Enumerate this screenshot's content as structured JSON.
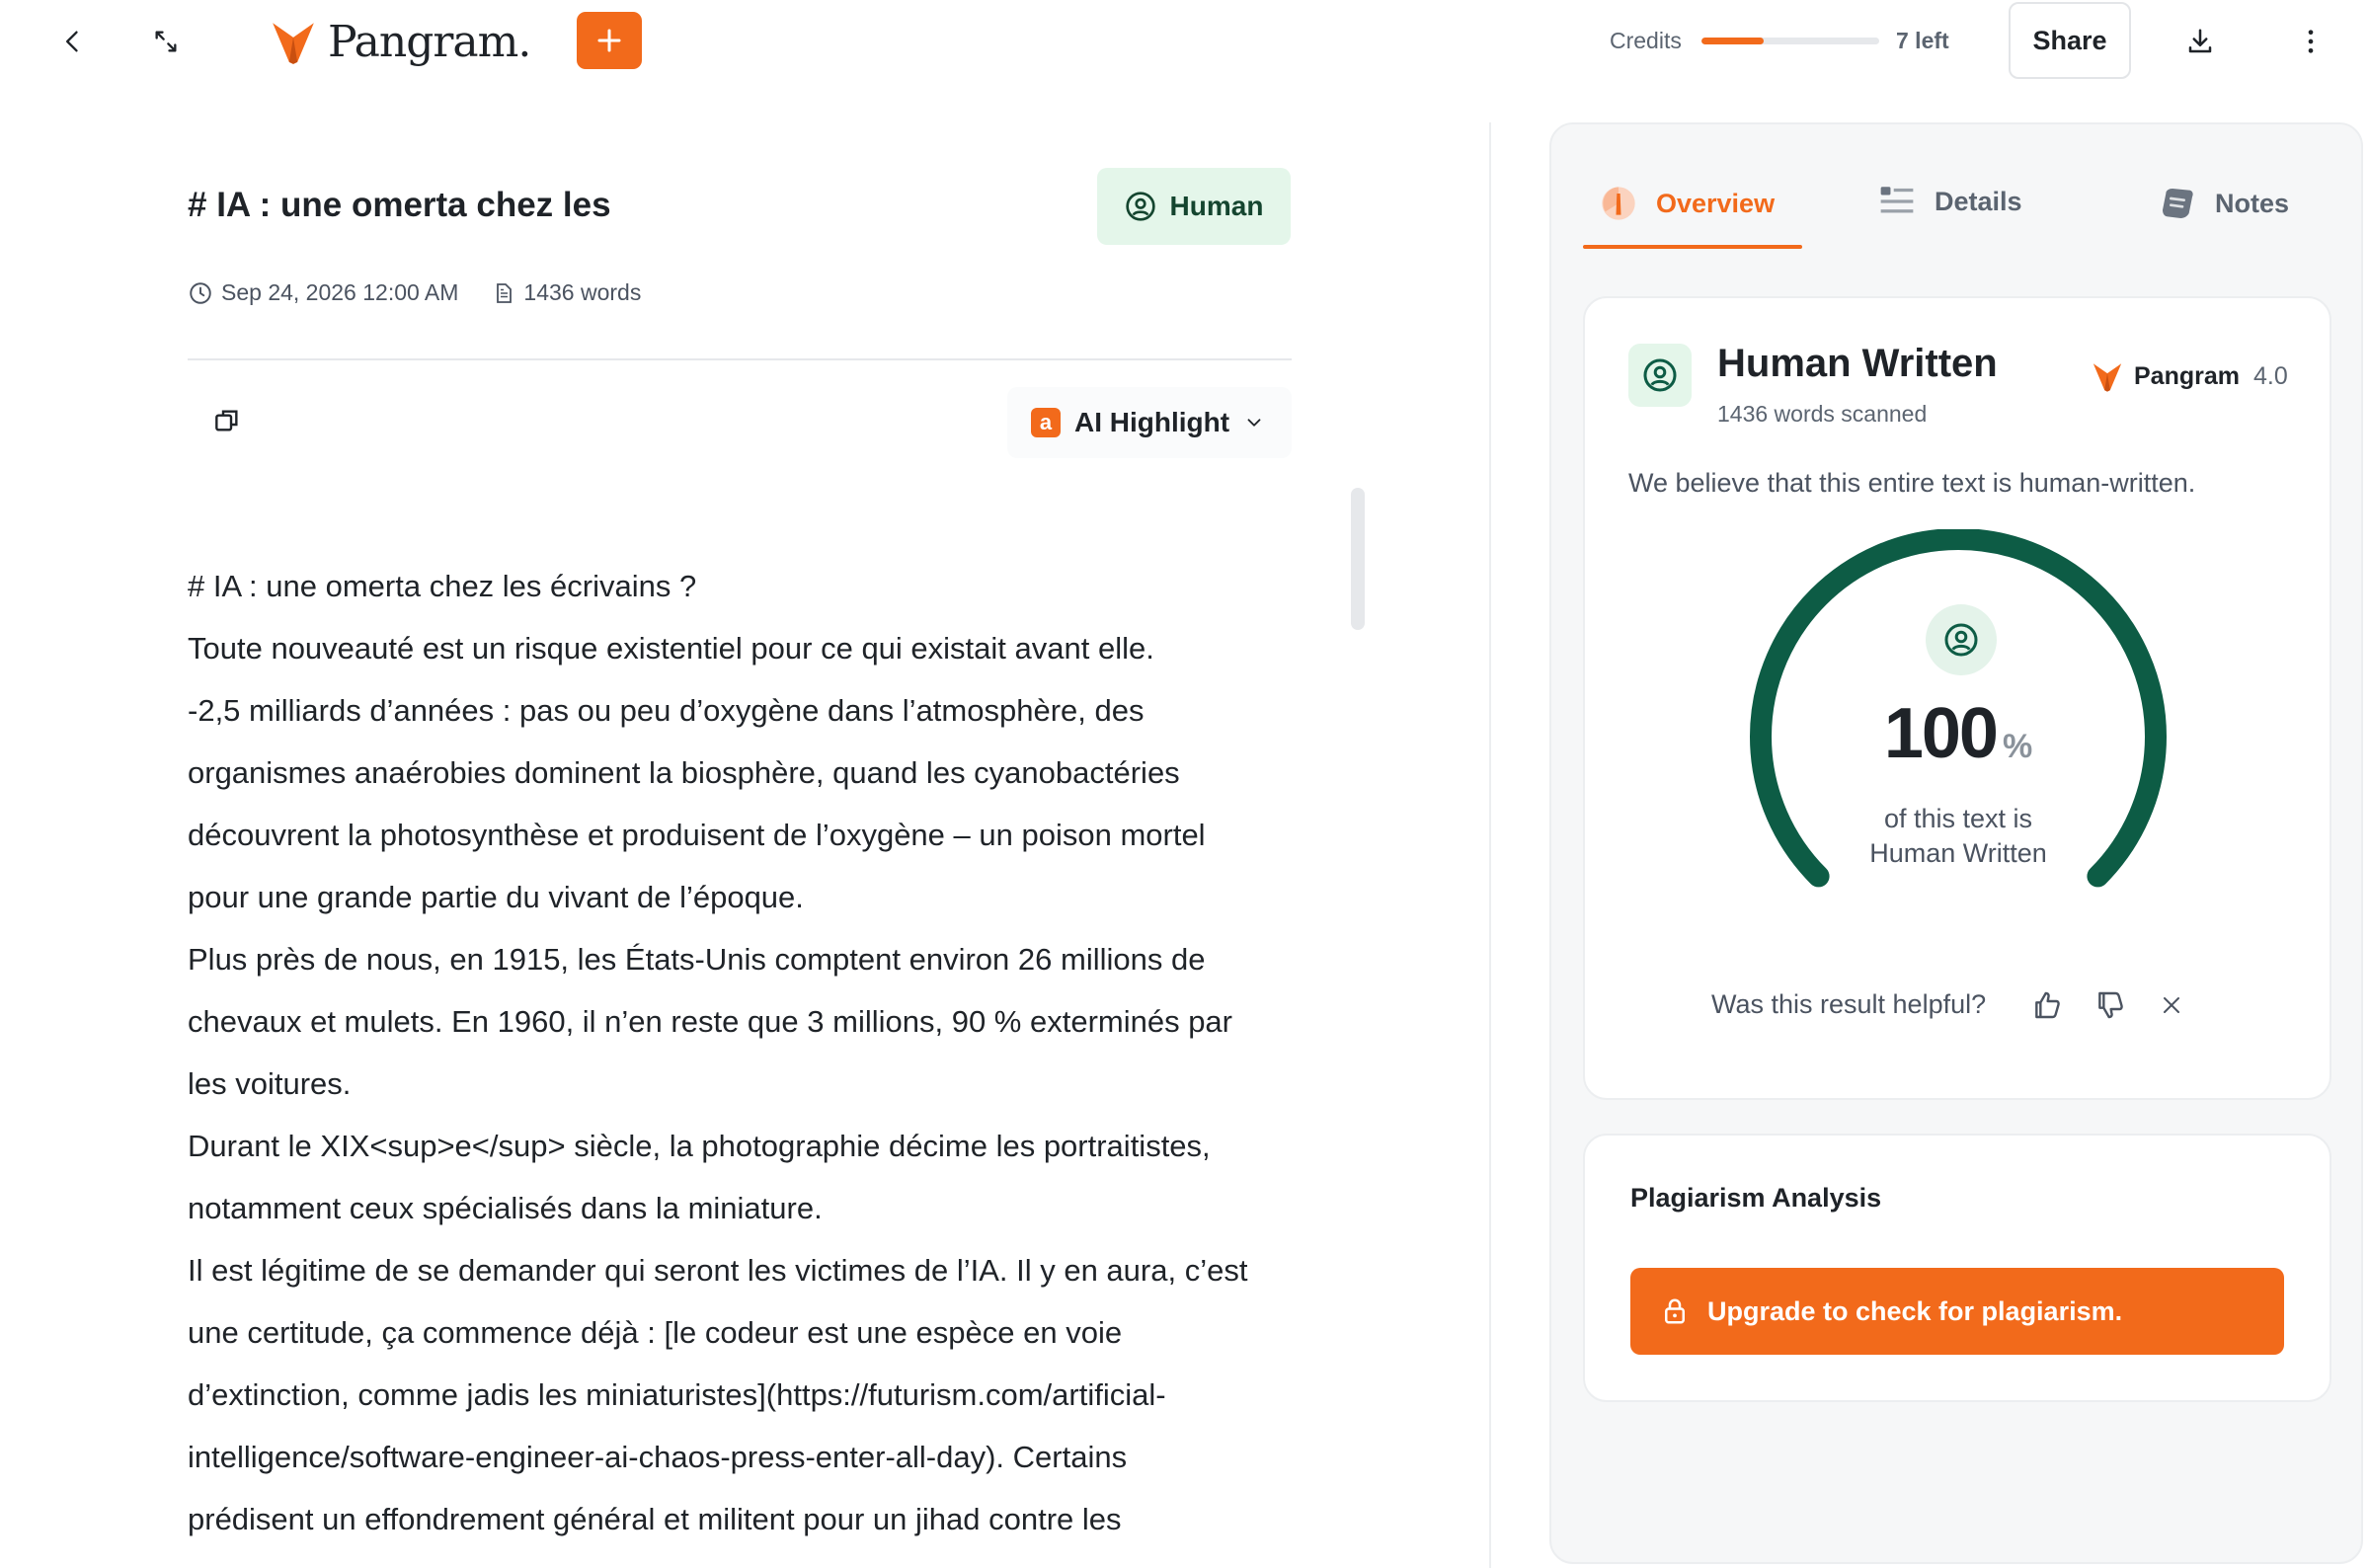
{
  "app": {
    "brand": "Pangram."
  },
  "topbar": {
    "credits_label": "Credits",
    "credits_fraction": 0.35,
    "credits_left": "7 left",
    "share_label": "Share"
  },
  "document": {
    "title": "# IA : une omerta chez les",
    "badge_label": "Human",
    "date": "Sep 24, 2026 12:00 AM",
    "word_count": "1436 words",
    "highlight_label": "AI Highlight",
    "lines": [
      "# IA : une omerta chez les écrivains ?",
      "Toute nouveauté est un risque existentiel pour ce qui existait avant elle.",
      "-2,5 milliards d’années : pas ou peu d’oxygène dans l’atmosphère, des",
      "organismes anaérobies dominent la biosphère, quand les cyanobactéries",
      "découvrent la photosynthèse et produisent de l’oxygène – un poison mortel",
      "pour une grande partie du vivant de l’époque.",
      "Plus près de nous, en 1915, les États-Unis comptent environ 26 millions de",
      "chevaux et mulets. En 1960, il n’en reste que 3 millions, 90 % exterminés par",
      "les voitures.",
      "Durant le XIX<sup>e</sup> siècle, la photographie décime les portraitistes,",
      "notamment ceux spécialisés dans la miniature.",
      "Il est légitime de se demander qui seront les victimes de l’IA. Il y en aura, c’est",
      "une certitude, ça commence déjà : [le codeur est une espèce en voie",
      "d’extinction, comme jadis les miniaturistes](https://futurism.com/artificial-",
      "intelligence/software-engineer-ai-chaos-press-enter-all-day). Certains",
      "prédisent un effondrement général et militent pour un jihad contre les"
    ]
  },
  "panel": {
    "tabs": [
      {
        "label": "Overview",
        "icon": "pie-chart-icon"
      },
      {
        "label": "Details",
        "icon": "list-icon"
      },
      {
        "label": "Notes",
        "icon": "notes-icon"
      }
    ],
    "result": {
      "title": "Human Written",
      "subtitle": "1436 words scanned",
      "model_name": "Pangram",
      "model_version": "4.0",
      "summary": "We believe that this entire text is human-written.",
      "percent": "100",
      "percent_value": 100,
      "percent_sign": "%",
      "caption_line1": "of this text is",
      "caption_line2": "Human Written",
      "helpful_question": "Was this result helpful?"
    },
    "plagiarism": {
      "title": "Plagiarism Analysis",
      "upgrade_label": "Upgrade to check for plagiarism."
    }
  },
  "colors": {
    "accent": "#f26a1b",
    "human_green": "#0d5c45",
    "human_badge_bg": "#e4f6ea"
  }
}
